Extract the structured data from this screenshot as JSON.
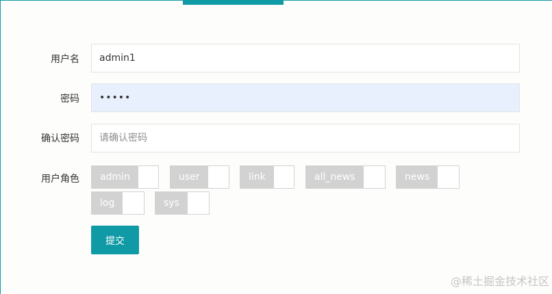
{
  "form": {
    "username": {
      "label": "用户名",
      "value": "admin1"
    },
    "password": {
      "label": "密码",
      "value": "•••••"
    },
    "confirm_password": {
      "label": "确认密码",
      "placeholder": "请确认密码"
    },
    "roles": {
      "label": "用户角色",
      "items": [
        {
          "name": "admin"
        },
        {
          "name": "user"
        },
        {
          "name": "link"
        },
        {
          "name": "all_news"
        },
        {
          "name": "news"
        },
        {
          "name": "log"
        },
        {
          "name": "sys"
        }
      ]
    },
    "submit_label": "提交"
  },
  "colors": {
    "accent": "#0f9aa6",
    "switch_off": "#d2d2d2",
    "autofill": "#e8f0fe"
  },
  "watermark": "@稀土掘金技术社区"
}
